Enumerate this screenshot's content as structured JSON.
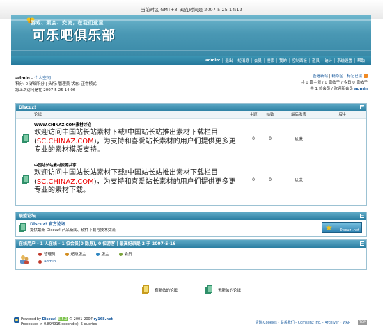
{
  "timebar": {
    "text": "当前时区 GMT+8, 现在时间是 2007-5-25 14:12"
  },
  "header": {
    "slogan": "游戏、聚会、交流，在我们这里",
    "logo": "可乐吧俱乐部"
  },
  "menu": {
    "items": [
      "admin:",
      "退出",
      "短消息",
      "会员",
      "搜索",
      "我的",
      "控制面板",
      "道具",
      "统计",
      "系统设置",
      "帮助"
    ]
  },
  "user": {
    "name": "admin",
    "space_link": "个人空间",
    "line2": "积分: 0 详细积分 | 头衔: 管理员 状态: 正常模式",
    "line3": "您上次访问是在 2007-5-25 14:06"
  },
  "rightinfo": {
    "links": [
      "查看新帖",
      "精华区",
      "标记已读"
    ],
    "stats1": "共 0 篇主题 / 0 篇帖子 / 今日 0 篇帖子",
    "stats2_prefix": "共 1 位会员 / 欢迎新会员 ",
    "stats2_name": "admin"
  },
  "category": {
    "title": "Discuz!",
    "headers": [
      "论坛",
      "主题",
      "帖数",
      "最后发表",
      "版主"
    ],
    "forums": [
      {
        "name": "WWW.CHINAZ.COM素材讨论",
        "desc_pre": "欢迎访问中国站长站素材下载!中国站长站推出素材下载栏目(",
        "desc_red": "SC.CHINAZ.COM",
        "desc_post": ")，为支持和喜爱站长素材的用户们提供更多更专业的素材模版支持。",
        "topics": "0",
        "posts": "0",
        "last": "从未",
        "moderator": ""
      },
      {
        "name": "中国站长站素材资源共享",
        "desc_pre": "欢迎访问中国站长站素材下载!中国站长站推出素材下载栏目(",
        "desc_red": "SC.CHINAZ.COM",
        "desc_post": ")，为支持和喜爱站长素材的用户们提供更多更专业的素材下载。",
        "topics": "0",
        "posts": "0",
        "last": "从未",
        "moderator": ""
      }
    ]
  },
  "league": {
    "title": "联盟论坛",
    "name": "Discuz! 官方论坛",
    "desc": "提供最新 Discuz! 产品新闻、软件下载与技术交流",
    "badge": "Discuz!.net"
  },
  "online": {
    "title": "在线用户 - 1 人在线 - 1 位会员(0 隐身), 0 位游客 | 最高纪录是 2 于 2007-5-16",
    "legend": [
      "管理员",
      "超级版主",
      "版主",
      "会员"
    ],
    "legend_colors": [
      "#c0392b",
      "#d38d1e",
      "#2e86c1",
      "#7aa33a"
    ],
    "user": "admin"
  },
  "bottom_legend": [
    "有新帖的论坛",
    "无新帖的论坛"
  ],
  "footer": {
    "powered_pre": "Powered by ",
    "discuz": "Discuz!",
    "ver": "5.5.0",
    "copyright": " © 2001-2007 ",
    "site": "ry168.net",
    "processed": "Processed in 0.894916 second(s), 5 queries",
    "right_links": "清除 Cookies - 联系我们 - Comsenz Inc. - Archiver - WAP",
    "top": "TOP"
  }
}
